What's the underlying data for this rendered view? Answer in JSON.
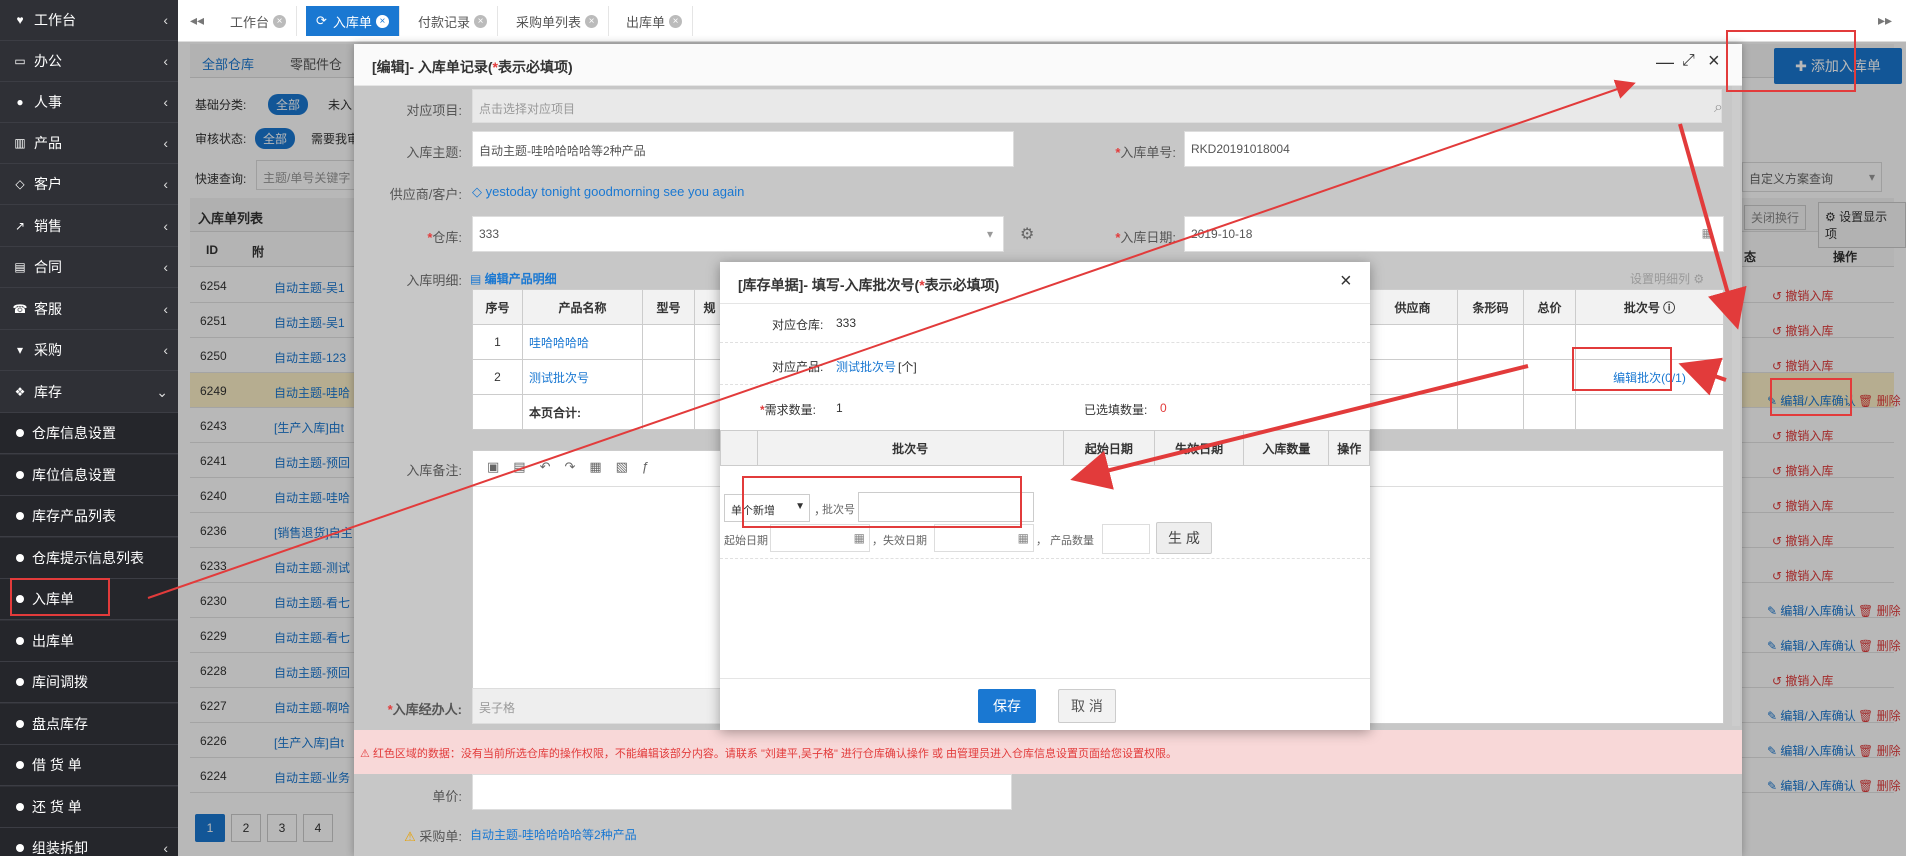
{
  "sidebar": {
    "items": [
      {
        "label": "工作台",
        "icon": "heart-icon"
      },
      {
        "label": "办公",
        "icon": "laptop-icon"
      },
      {
        "label": "人事",
        "icon": "users-icon"
      },
      {
        "label": "产品",
        "icon": "barcode-icon"
      },
      {
        "label": "客户",
        "icon": "diamond-icon"
      },
      {
        "label": "销售",
        "icon": "chart-icon"
      },
      {
        "label": "合同",
        "icon": "card-icon"
      },
      {
        "label": "客服",
        "icon": "phone-icon"
      },
      {
        "label": "采购",
        "icon": "cart-icon"
      },
      {
        "label": "库存",
        "icon": "cubes-icon"
      }
    ],
    "sub_items": [
      "仓库信息设置",
      "库位信息设置",
      "库存产品列表",
      "仓库提示信息列表",
      "入库单",
      "出库单",
      "库间调拨",
      "盘点库存",
      "借 货 单",
      "还 货 单",
      "组装拆卸"
    ]
  },
  "tabs": [
    "工作台",
    "入库单",
    "付款记录",
    "采购单列表",
    "出库单"
  ],
  "main": {
    "wh_tabs": [
      "全部仓库",
      "零配件仓"
    ],
    "filter1_label": "基础分类:",
    "filter1_value": "全部",
    "filter1_next": "未入",
    "filter2_label": "审核状态:",
    "filter2_value": "全部",
    "filter2_next": "需要我审",
    "quick_label": "快速查询:",
    "quick_placeholder": "主题/单号关键字",
    "list_title": "入库单列表",
    "col_id": "ID",
    "col_attach": "附",
    "col_ops": "操作",
    "col_status": "态",
    "add_btn": "添加入库单",
    "custom_query": "自定义方案查询",
    "close_wrap": "关闭换行",
    "display_settings": "设置显示项",
    "rows": [
      {
        "id": "6254",
        "t": "自动主题-吴1",
        "op": "撤销入库"
      },
      {
        "id": "6251",
        "t": "自动主题-吴1",
        "op": "撤销入库"
      },
      {
        "id": "6250",
        "t": "自动主题-123",
        "op": "撤销入库"
      },
      {
        "id": "6249",
        "t": "自动主题-哇哈",
        "op": "编辑/入库确认",
        "del": "删除"
      },
      {
        "id": "6243",
        "t": "[生产入库]由t",
        "op": "撤销入库"
      },
      {
        "id": "6241",
        "t": "自动主题-预回",
        "op": "撤销入库"
      },
      {
        "id": "6240",
        "t": "自动主题-哇哈",
        "op": "撤销入库"
      },
      {
        "id": "6236",
        "t": "[销售退货]自主",
        "op": "撤销入库"
      },
      {
        "id": "6233",
        "t": "自动主题-测试",
        "op": "撤销入库"
      },
      {
        "id": "6230",
        "t": "自动主题-看七",
        "op": "编辑/入库确认",
        "del": "删除"
      },
      {
        "id": "6229",
        "t": "自动主题-看七",
        "op": "编辑/入库确认",
        "del": "删除"
      },
      {
        "id": "6228",
        "t": "自动主题-预回",
        "op": "撤销入库"
      },
      {
        "id": "6227",
        "t": "自动主题-啊哈",
        "op": "编辑/入库确认",
        "del": "删除"
      },
      {
        "id": "6226",
        "t": "[生产入库]自t",
        "op": "编辑/入库确认",
        "del": "删除"
      },
      {
        "id": "6224",
        "t": "自动主题-业务",
        "op": "编辑/入库确认",
        "del": "删除"
      }
    ],
    "pages": [
      "1",
      "2",
      "3",
      "4"
    ]
  },
  "edit": {
    "title": "[编辑]- 入库单记录(",
    "title_hint": "表示必填项)",
    "project_label": "对应项目:",
    "project_placeholder": "点击选择对应项目",
    "subject_label": "入库主题:",
    "subject_value": "自动主题-哇哈哈哈哈等2种产品",
    "no_label": "入库单号:",
    "no_value": "RKD20191018004",
    "supplier_label": "供应商/客户:",
    "supplier_value": "yestoday tonight goodmorning see you again",
    "wh_label": "仓库:",
    "wh_value": "333",
    "date_label": "入库日期:",
    "date_value": "2019-10-18",
    "detail_label": "入库明细:",
    "detail_link": "编辑产品明细",
    "detail_settings": "设置明细列",
    "cols": [
      "序号",
      "产品名称",
      "型号",
      "规"
    ],
    "cols_right": [
      "供应商",
      "条形码",
      "总价",
      "批次号"
    ],
    "prod_rows": [
      {
        "no": "1",
        "name": "哇哈哈哈哈"
      },
      {
        "no": "2",
        "name": "测试批次号"
      }
    ],
    "batch_link": "编辑批次(0/1)",
    "subtotal": "本页合计:",
    "remark_label": "入库备注:",
    "handler_label": "入库经办人:",
    "handler_value": "吴子格",
    "warning": "红色区域的数据：没有当前所选仓库的操作权限，不能编辑该部分内容。请联系 \"刘建平,吴子格\" 进行仓库确认操作 或 由管理员进入仓库信息设置页面给您设置权限。",
    "price_label": "单价:",
    "po_label": "采购单:",
    "po_value": "自动主题-哇哈哈哈哈等2种产品"
  },
  "dialog": {
    "title": "[库存单据]- 填写-入库批次号(",
    "title_hint": "表示必填项)",
    "wh_label": "对应仓库:",
    "wh_value": "333",
    "prod_label": "对应产品:",
    "prod_value": "测试批次号",
    "prod_unit": "[个]",
    "need_label": "需求数量:",
    "need_value": "1",
    "filled_label": "已选填数量:",
    "filled_value": "0",
    "cols": [
      "批次号",
      "起始日期",
      "失效日期",
      "入库数量",
      "操作"
    ],
    "mode_value": "单个新增",
    "batch_label": "批次号",
    "start_label": "起始日期",
    "expire_label": "失效日期",
    "qty_label": "产品数量",
    "gen_btn": "生 成",
    "save_btn": "保存",
    "cancel_btn": "取 消"
  },
  "colors": {
    "accent": "#1a78d2",
    "annotation": "#e23b3b",
    "sidebar": "#2f3036"
  }
}
